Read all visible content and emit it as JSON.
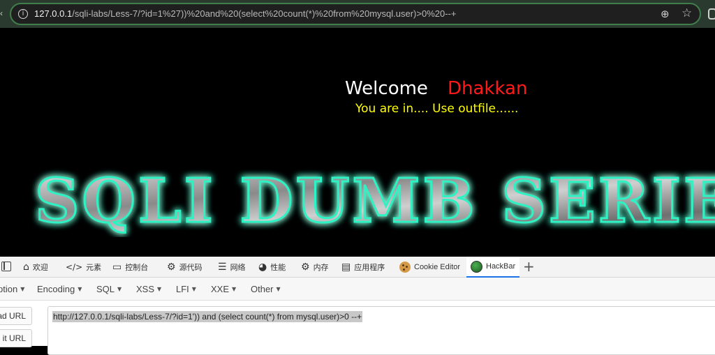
{
  "browser": {
    "url_host": "127.0.0.1",
    "url_path": "/sqli-labs/Less-7/?id=1%27))%20and%20(select%20count(*)%20from%20mysql.user)>0%20--+",
    "icons": {
      "site_info": "info-icon",
      "zoom": "zoom-icon",
      "bookmark": "star-icon"
    }
  },
  "page": {
    "welcome_label": "Welcome",
    "user_name": "Dhakkan",
    "status_message": "You are in.... Use outfile......",
    "banner_text": "SQLI DUMB SERIE",
    "colors": {
      "background": "#000000",
      "welcome": "#ffffff",
      "user": "#ff1a1a",
      "status": "#ffff00",
      "banner_glow": "#2ef2c4"
    }
  },
  "devtools": {
    "tabs": [
      {
        "label": "欢迎",
        "icon": "home-icon"
      },
      {
        "label": "元素",
        "icon": "code-icon"
      },
      {
        "label": "控制台",
        "icon": "console-icon"
      },
      {
        "label": "源代码",
        "icon": "bug-icon"
      },
      {
        "label": "网络",
        "icon": "wifi-icon"
      },
      {
        "label": "性能",
        "icon": "gauge-icon"
      },
      {
        "label": "内存",
        "icon": "memory-icon"
      },
      {
        "label": "应用程序",
        "icon": "application-icon"
      },
      {
        "label": "Cookie Editor",
        "icon": "cookie-icon"
      },
      {
        "label": "HackBar",
        "icon": "hackbar-logo-icon",
        "active": true
      }
    ]
  },
  "hackbar": {
    "menu": [
      "ption",
      "Encoding",
      "SQL",
      "XSS",
      "LFI",
      "XXE",
      "Other"
    ],
    "load_url_label": "ad URL",
    "split_url_label": "it URL",
    "url_value": "http://127.0.0.1/sqli-labs/Less-7/?id=1')) and (select count(*) from mysql.user)>0 --+"
  }
}
